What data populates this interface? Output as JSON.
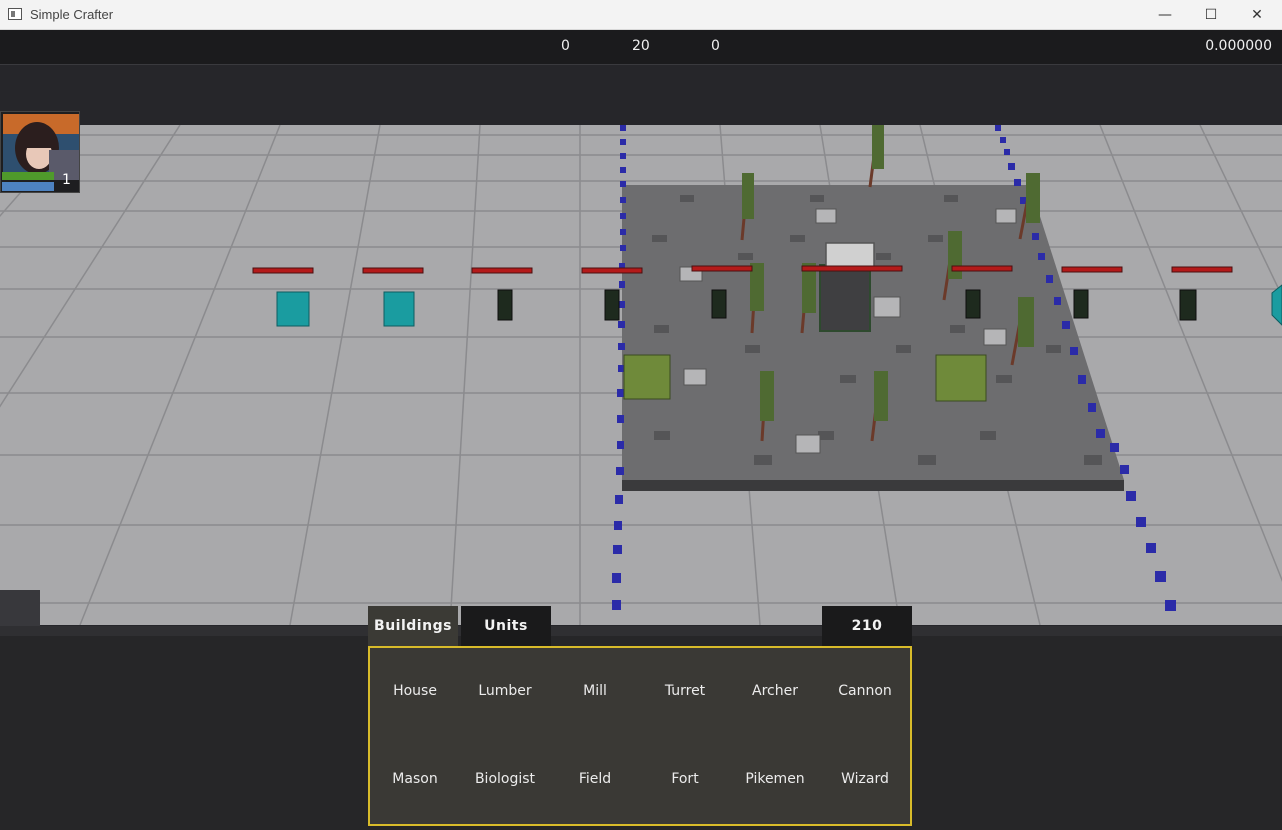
{
  "window": {
    "title": "Simple Crafter",
    "minimize_glyph": "—",
    "maximize_glyph": "☐",
    "close_glyph": "✕"
  },
  "hud": {
    "value_a": "0",
    "value_b": "20",
    "value_c": "0",
    "time": "0.000000"
  },
  "hero": {
    "level": "1",
    "hp_fraction": 1.0,
    "mp_fraction": 1.0
  },
  "tabs": [
    {
      "label": "Buildings",
      "active": true
    },
    {
      "label": "Units",
      "active": false
    }
  ],
  "resources": {
    "count": "210"
  },
  "build_menu": {
    "rows": [
      [
        "House",
        "Lumber",
        "Mill",
        "Turret",
        "Archer",
        "Cannon"
      ],
      [
        "Mason",
        "Biologist",
        "Field",
        "Fort",
        "Pikemen",
        "Wizard"
      ]
    ]
  },
  "colors": {
    "ground": "#a8a8aa",
    "grid": "#8a8a8d",
    "plateau": "#6b6b6d",
    "border_dots": "#2a2aa8",
    "health_bar": "#b01818",
    "teal_unit": "#1a9a9e",
    "menu_border": "#d8bb2a"
  }
}
